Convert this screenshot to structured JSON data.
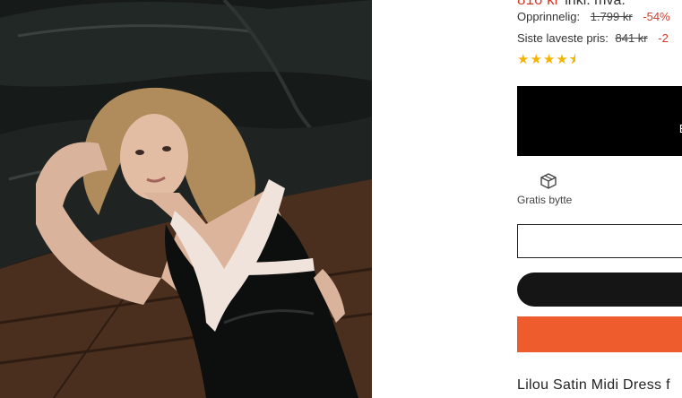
{
  "product": {
    "price_current": "816 kr",
    "price_vat_note": "inkl. mva.",
    "original_label": "Opprinnelig:",
    "original_price": "1.799 kr",
    "original_discount": "-54%",
    "lowest_label": "Siste laveste pris:",
    "lowest_price": "841 kr",
    "lowest_discount": "-2",
    "rating_stars": "★★★★⯨",
    "rating_value": 4.5,
    "primary_box_label": "Ek",
    "exchange_icon": "box-icon",
    "exchange_label": "Gratis bytte",
    "name": "Lilou Satin Midi Dress f"
  },
  "colors": {
    "sale_red": "#d23b2a",
    "star": "#f4b400",
    "cta_orange": "#ee5b2d",
    "cta_dark": "#151515"
  }
}
